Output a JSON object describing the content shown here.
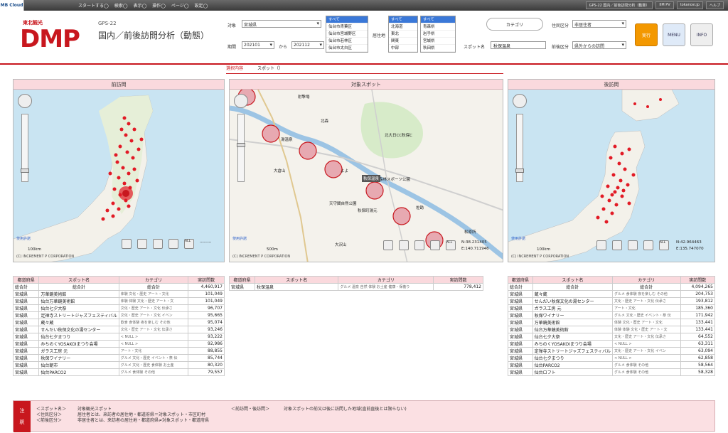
{
  "topbar": {
    "brand": "MB Cloud",
    "menu": [
      "スタートする◯",
      "検索◯",
      "表示◯",
      "操作◯",
      "ページ◯",
      "設定◯"
    ],
    "right": [
      "GPS-22 国内／前後訪問分析（動態）",
      "IIM PV",
      "tokanosi.jp",
      "ヘルプ"
    ]
  },
  "header": {
    "logo_small": "東北観光",
    "logo_big": "DMP",
    "screen_id": "GPS-22",
    "title": "国内／前後訪問分析（動態）"
  },
  "form": {
    "target_label": "対象",
    "target_value": "宮城県",
    "target_list": [
      "すべて",
      "仙台市青葉区",
      "仙台市宮城野区",
      "仙台市若林区",
      "仙台市太白区"
    ],
    "residence_label": "居住地",
    "residence_list": [
      "すべて",
      "北海道",
      "東北",
      "関東",
      "中部"
    ],
    "pref_list": [
      "すべて",
      "青森県",
      "岩手県",
      "宮城県",
      "秋田県"
    ],
    "period_label": "期間",
    "period_from": "202101",
    "period_mid": "から",
    "period_to": "202112",
    "spot_label": "スポット名",
    "spot_value": "秋保温泉",
    "category_btn": "カテゴリ",
    "resident_label": "住民区分",
    "resident_value": "非居住者",
    "visit_label": "前後区分",
    "visit_value": "県外からの訪問",
    "run_btn": "実行",
    "menu_btn": "MENU",
    "info_btn": "INFO"
  },
  "tabs": [
    "選択内容",
    "スポット（）"
  ],
  "panels": {
    "left_title": "前訪問",
    "center_title": "対象スポット",
    "right_title": "後訪問",
    "copyright": "(C) INCREMENT P CORPORATION",
    "usage": "使用許諾",
    "scale_left": "100km",
    "scale_center": "500m",
    "scale_right": "100km",
    "center_coord_n": "N:38.231405",
    "center_coord_e": "E:140.711946",
    "right_coord_n": "N:42.964463",
    "right_coord_e": "E:135.747070",
    "all_label": "ALL",
    "dots": "---------"
  },
  "center_map_labels": {
    "top": "射撃場",
    "onsen_left": "湯温泉",
    "kitamori": "北森",
    "tashiro": "北大日CC秋保C",
    "daikuzan": "大倉山",
    "yoyo": "よよ",
    "resort": "リゾート森林スポーツ公園",
    "popup": "秋保温泉",
    "tenmou": "天守閣自然公園",
    "akiyu": "秋保町湯元",
    "sakura": "佐勘",
    "ooyama": "大沢山",
    "kurosaki": "松原所"
  },
  "table_headers": [
    "都道府県",
    "スポット名",
    "カテゴリ",
    "実訪問数"
  ],
  "total_label": "総合計",
  "left_table": {
    "total": "4,460,917",
    "rows": [
      [
        "宮城県",
        "万華鏡美術館",
        "体験 文化・歴史 アート・文化",
        "101,049"
      ],
      [
        "宮城県",
        "仙台万華鏡美術館",
        "体験 体験 文化・歴史 アート・文",
        "101,049"
      ],
      [
        "宮城県",
        "仙台七夕大祭",
        "文化・歴史 アート・文化 伝承さ",
        "96,707"
      ],
      [
        "宮城県",
        "定禅寺ストリートジャズフェスティバル",
        "文化・歴史 アート・文化 イベン",
        "95,665"
      ],
      [
        "宮城県",
        "蔵々蔵",
        "飲食 食体験 夜を楽しむ その他",
        "95,074"
      ],
      [
        "宮城県",
        "せんだい秋保文化の湯センター",
        "文化・歴史 アート・文化 伝承さ",
        "93,246"
      ],
      [
        "宮城県",
        "仙台七夕まつり",
        "< NULL >",
        "93,222"
      ],
      [
        "宮城県",
        "みちのくYOSAKOIまつり会場",
        "< NULL >",
        "92,986"
      ],
      [
        "宮城県",
        "ガラス工房 元",
        "アート・文化",
        "88,855"
      ],
      [
        "宮城県",
        "秋保ワイナリー",
        "グルメ 文化・歴史 イベント・祭 伝",
        "85,744"
      ],
      [
        "宮城県",
        "仙台朝市",
        "グルメ 文化・歴史 食体験 お土産",
        "80,320"
      ],
      [
        "宮城県",
        "仙台PARCO2",
        "グルメ 食体験 その他",
        "79,557"
      ]
    ]
  },
  "center_table": {
    "rows": [
      [
        "宮城県",
        "秋保温泉",
        "グルメ 温泉 自然 体験 お土産 健康・保養り",
        "778,412"
      ]
    ]
  },
  "right_table": {
    "total": "4,094,265",
    "rows": [
      [
        "宮城県",
        "蔵々蔵",
        "グルメ 食体験 夜を楽しむ その他",
        "204,753"
      ],
      [
        "宮城県",
        "せんだい秋保文化の湯センター",
        "文化・歴史 アート・文化 伝承さ",
        "193,812"
      ],
      [
        "宮城県",
        "ガラス工房 元",
        "アート・文化",
        "185,360"
      ],
      [
        "宮城県",
        "秋保ワイナリー",
        "グルメ 文化・歴史 イベント・祭 伝",
        "171,942"
      ],
      [
        "宮城県",
        "万華鏡美術館",
        "体験 文化・歴史 アート・文化",
        "133,441"
      ],
      [
        "宮城県",
        "仙台万華鏡美術館",
        "体験 体験 文化・歴史 アート・文",
        "133,441"
      ],
      [
        "宮城県",
        "仙台七夕大祭",
        "文化・歴史 アート・文化 伝承さ",
        "64,552"
      ],
      [
        "宮城県",
        "みちのくYOSAKOIまつり会場",
        "< NULL >",
        "63,311"
      ],
      [
        "宮城県",
        "定禅寺ストリートジャズフェスティバル",
        "文化・歴史 アート・文化 イベン",
        "63,094"
      ],
      [
        "宮城県",
        "仙台七夕まつり",
        "< NULL >",
        "62,858"
      ],
      [
        "宮城県",
        "仙台PARCO2",
        "グルメ 食体験 その他",
        "58,564"
      ],
      [
        "宮城県",
        "仙台ロフト",
        "グルメ 食体験 その他",
        "58,328"
      ]
    ]
  },
  "note": {
    "head1": "注",
    "head2": "釈",
    "col1_keys": [
      "＜スポット名＞",
      "＜住民区分＞",
      "＜前後区分＞"
    ],
    "col1_vals": [
      "対象観光スポット",
      "居住者とは、来訪者の居住地・都道府県＝対象スポット・市区町村",
      "非居住者とは、来訪者の居住地・都道府県≠対象スポット・都道府県"
    ],
    "col2_key": "＜前訪問・後訪問＞",
    "col2_val": "対象スポットの前又は後に訪問した地域(直前直後とは限らない)"
  },
  "colors": {
    "accent": "#c8171e",
    "pink": "#fad9dd",
    "run": "#f39800",
    "blue": "#3a78d8"
  }
}
